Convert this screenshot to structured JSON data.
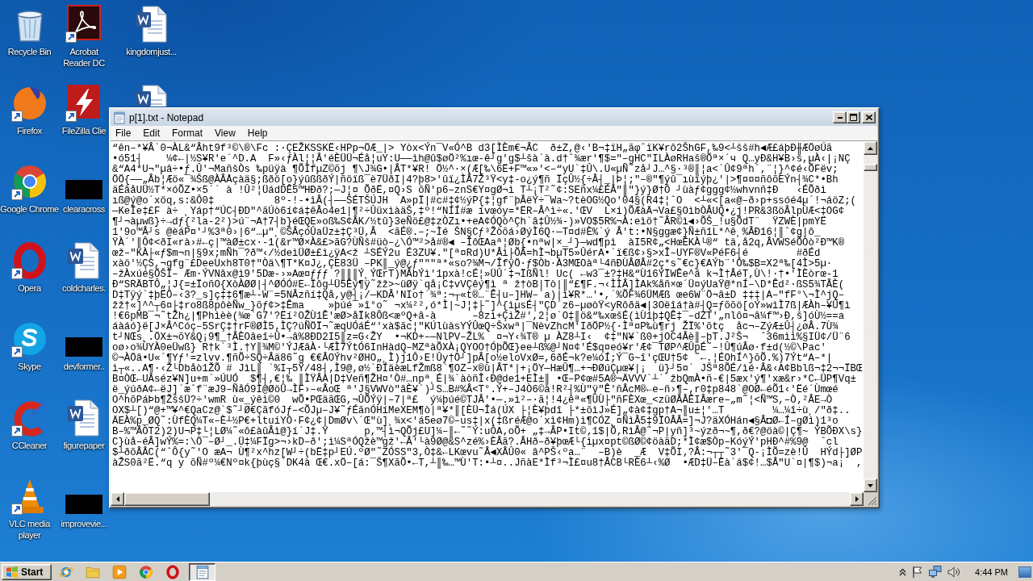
{
  "desktop": {
    "columns": [
      [
        {
          "kind": "recycle-bin",
          "label": "Recycle Bin",
          "shortcut": false
        },
        {
          "kind": "firefox",
          "label": "Firefox",
          "shortcut": true
        },
        {
          "kind": "chrome",
          "label": "Google Chrome",
          "shortcut": true
        },
        {
          "kind": "opera",
          "label": "Opera",
          "shortcut": true
        },
        {
          "kind": "skype",
          "label": "Skype",
          "shortcut": true
        },
        {
          "kind": "ccleaner",
          "label": "CCleaner",
          "shortcut": true
        },
        {
          "kind": "vlc",
          "label": "VLC media player",
          "shortcut": true
        }
      ],
      [
        {
          "kind": "acrobat",
          "label": "Acrobat Reader DC",
          "shortcut": true
        },
        {
          "kind": "filezilla",
          "label": "FileZilla Clie",
          "shortcut": true
        },
        {
          "kind": "redacted",
          "label": "clearacross"
        },
        {
          "kind": "word",
          "label": "coldcharles.",
          "shortcut": false
        },
        {
          "kind": "redacted",
          "label": "devformer.."
        },
        {
          "kind": "word",
          "label": "figurepaper",
          "shortcut": false
        },
        {
          "kind": "redacted",
          "label": "improvevie..."
        }
      ],
      [
        {
          "kind": "word",
          "label": "kingdomjust...",
          "shortcut": false
        },
        {
          "kind": "word"
        }
      ]
    ]
  },
  "notepad": {
    "title": "p[1].txt - Notepad",
    "menu": [
      "File",
      "Edit",
      "Format",
      "View",
      "Help"
    ],
    "lines": [
      "“ên–*¥Â`0¬ÀL&“Âht9f³©\\®\\Fc :·ÇEŽKSSKË‹HPp¬ÖÆ_|> Yòx<Ýn¯V«Ó^B d3[ÌÈm€¬ÂC  ð±Z,@‹'B¬‡ïH„ãφˆïK¥rô2ŠhGF,‰9<┴šš#h◄Æ£áþÐ╫ÆÖøÚã",
      "•ó51┤    ¼¢←|½S¥R'e´^D.A  F»‹ƒÀl¦¦Â'éÈÜÜ¬Éå¦uY:U——ìh@û$øÖ²%ıœ-ê┘g'g$┴šà´à.d†ˆ¾ær'¶$=\"–gHC\"ILÀøRHaš®Õª×´ч Q…yÐ&H¥B›š,µÀ‹|¡NÇ",
      "&“A4*U¬\"µâ÷•ƒ.Û'¬MañšÒs ‰püÿà ¶ÕÌfµZ©õj ¶\\J¾G•|ÂT*¥R! Ö½^·×(Æ[‰\\6Ë+F™«»'<–“yU`‡Û\\.U«µÑ˜zå┘J…^§·³®║¦a<`Û¢9ªh´,¨¦}^¢é‹ÕFëv;",
      "ÖÖ{——„Âb¦Æö«¯¾Šß@ÀÂÅçàä§;ßðö[o}ýûßßðÝ|ñöïß¯è7ÜðI|4?þ8>'ûï¿ÌÂ7Ž³Ÿ<y‡-o¿ý¶ñ ÏçÛ½{÷Â┤_|Þ¦;\"–®\"¶ýû¯ıùïýþ¿'|>¶¤¤¤ñôõEÝn┤¾C*•Bh",
      "äÉâåUÜ½T*×óÕZ•×5´` à !Û²¦ÜádDÊ5™HÐð?;—J¦¤ ÕðË,¤Q›S õÑ'p6–znS€Y¤gØ¬ì T┴¡T²˜¢:SEñx¼£ÉÂ\"║\"}ý}Ø†Ô ┘ùàƒ¢ggg¢½whvnñ‡Ð   ‹ÉÕðì",
      "ıß@ý@o´xöq,s:&Ô0‡          8º-!-•ìÂ(┤——ŠÉTŠÚJH  A»pÏ|#c#‡¢½ýP{‡¦gf¨þÂëÝ÷¯Wa~?tèOG½Qo'04§(R4‡¦ˆO  <┴«<[a«@–ð›p+ssóé4µ´!¬áöZ;(",
      "—KeÎe‡£F à÷ ¸Yáp†“ÚC┤ÐD\"^ãÚò6í¢á‡êÂo4e1|¶²÷ÛüxìàäŠ,‡º!“NÍÍ#æ ívœóy=*ËR–Â^ì÷«.'ŒV  L×i)ÕÆàÄ¬Va£§OìbÒÂUQ•¿j!PR&3ßöÂlpÙÆ<‡OG¢",
      "¶┘¬àµwß}÷→dƒ{²la-2²)>ú¨¬A†7┤b}éŒQE»oß‰S¢ÂK/½tû}3eÑö£@‡zÒZı•+eA¢ÓQò^Çh`â‡Û½¾-)»VO$5R%¬À:eìö†˜ÂR©ì◄›ÕŠ_!u§ÕdT¨  ŸZWÈ|pmYË",
      "1'9o™Â┘s @èáP¤'┘%3ª0›|6“…µ\"¸©ŠÂçóÛaÜz±‡Ç³Ü,Â  <ãÉ®.–;~Ìé ŠN§Cƒ³Žòõá›ØýÌ6Q·—T¤d#È%´ý Â't:•N§ggæ¢}Ñ±ñ1L*^ê¸%ÂÐ16¦║ˆ¢g|ô_",
      "ŸÀ´'║Ô¢<ðI«rà›#←ç|™àØ±cx·-1(&r™Ø×À&£>ãG?ÙÑš#üò–¿\\Ó™²>å#®◄ –ÎôŒAaª¦Øb{•nªw|×_┘}—wd¶pì  àI5R¢„<HœÉKÀ└®“ tä‚å2q,ÂVWSéÕÒò²Ð™K®",
      "œž–\"KÀ├«ƒ$m¬n|§9x;mÑh¯?ð™‹/½deìÜØ±£ì¿ÿA<ž ┴SÉÝ2u É3ZU¥.\"[ª¤Rd)U*Âì├ÕÂ=hÌ¬bµT5»ÛérA•`ï€ß¢›§>xÎ–UYF®V«PéF6┤é        #ðÉd",
      "xàö'½ÇS,¬gfg¨£DeeUxh8T0†\"Òä\\¶T*K¤J¿,ÇE83Ü –PK║_ý@¿ƒ\"\"\"ª*«so?¾M¬/ÎfÿÖ·ƒ$Òb·À3MŒOàª└4ñÐÙÂØÂ#2ç*s˜€c}€AÝb¨'Ó‰$B=X2ª‰[4Ì>5µ·",
      "–žÀxúé§ÕŠÏ– Æm·ÝVNâx@ì9'5Dæ-›»Aœ¤ƒƒƒ ?║║║Ý¸ÝŒrT)MÂbÝì'1pxà!cÉ¦»ÜÛ´‡¬ÏßÑl! Uc( ←w3¯±?‡H&“Ù16ÝÏWÊe^ã k¬Ì†ÂéT,Ù\\!·†•'ÌÈòrœ-1",
      "Ð“SRÄBTÔ„¦J{=±ÏoñO{XòÀØØ|┤^ØÓÓ#E←Ïôg┴Ü5Éý¶ÿ˜žž>~üØÿ`qå¡C‡vVÇêý¶ì ª ž†òB|Tò|║“£¶F.¬‹ÌÌÂ]ÌAk%åñ×œ´Ü¤ýUaŸ@*nÍ–\\D*Êd²·ßS5¾TÂÈ(",
      "D‡Tÿý`‡þËÖ–‹3?_s]ç‡‡6¶æ┴-W¨=5NÂzñí‡Qå‚y@┤¡/—KDÂ'NIo†´¾ª:¬┬«t®…¨Ê┤u–]HW–´a)|ì¥R*…'•,´%ÕF¾6ÜMÆß œe6W¨Ö¬â±D ‡‡‡|A–\"fF°\\¬Ì^jQ–",
      "žž†«]^^┬6¤├‡ro8ß8pôèÑw_}õƒ¢>‡Êma    »þúé¯»î°o˜ ¬x¼²²,ó*Ì|~J¦‡├˜]^{ìµsÉ┤\"ÇD´z6–µøòŸ<yRôðä◄|3Oëîá†à#┤Q=ƒõõö[oÝ»wìÌ7ß|ÆÀh–¥Û¶ì",
      "!€6pMB¯¬˜tŽh¿|¶Phìèè(¾œ`G7'?Ëí²OŽÙ1Ê'æØ>åÏk8Ôß<æºQ+â-à      –8zì+ÇìŽ#',2¦ø`O‡║ö&“‰xœšÉ(ìÙ1þ‡QÊ‡¯–dZT'„nlô¤¬â¼f™›Ð,š]óÙ½==a",
      "áàáó}ë[J×Â^Cóç–5SrÇ‡†rF®ØÌ5‚ÌÇ?úÑÖÏ¬˜æqUÓáÉ“'xà$ãc¦\"KÚlùàsYÝÛœQ÷Šxwª|¯NèvZhcM'IðÖP½{·Ìª¤P‰ù¶rj ŽÏ%'õtç  åc¬–ZýÆ±Û┤¿øÂ.7Ù¾",
      "t┘NŒs¸.ÖX±¬õY&Q¡9¶_†ÂÈOâeî÷Û•→â%8ÐD2I5║z=G‹ŽY  •¬KD+–—NlPV–ŽL%  ¤¬Y‹¾T® µ ÀZ8┴I‹  ¢‡\"N¥`ß0+jOC4Âè║–þT.J²Š¬  ˆ36mìì%§IÜ¢/Ü¨6",
      "oø›o¾ÙYÀ0eÜwß} R†k`³Ì.†Y║¾M©'ÝJÆâÀ·└ÆÌ7ÝtÓ6InHàdQ–MZªàÕXÀ¡QYOO†ÓþÕŒ}ee┴ß%@┘N¤¢'É$q¤eó¥r'Æ¢¯TØP^ÆÛpÉ˜–!Û¶úÂø·f±d(½©\\Pac'",
      "©¬ÀÖâ•U«´¶Yƒ'=zlvv.¶ñÕ÷SQ÷Âä86˜g €€ÂOÝhv²ØHO„¸Ì)j1Ô›E!Ûy†Ö┘]pÂ[o½eloVxØ=,6ðÉ¬k?e¼óÍ;Ý¯G~î'çŒU†5¢ ˜←.¦ÉOhÍ^}õÕ.%)7Ýt“A–*|",
      "ì┬«..A¶·‹Ž└Dbåò1ŽÕ # JìL║ `%I┬5Ÿ/48┤‚Ì9@,ø½`ÐÍäèæLfŽmß8`¶OZ–x®ù|ÂT*|+¡ÖY—HæÛ¶…+¬ÐØúÇµœ¥|¡  ü}┘5¤´ JŠª8ÕÉ/ìé·Â&‹A¢Bblß¬‡2¬¬ÏBŒ",
      "B¤ÒŒ←UÂséz¥N]u+m´»ÚUÓ  $¶┤‚€¦‰ ║ÌŸÂA|D‡Veñ¶ŽH¤'Ò#…npª¸É|¾`àòñÎ‹Ð@de1+EÌ±║ •Œ–P¢œ#5A®¬ÄVVV`┴´ žbQmÀ•ñ-€|5æx'ý¶'xæ&r›*C←ÜP¶Vq±",
      "ë_ýúðA¢←ëJ]´æˆf¨æJ9–ÑåÓ9Ì@ØöÜ→ÌF›–«ÂoŒ ª'J§VWVò\"âÈ¥´)┘S…B#%Â<T°.Ý+–J4Ò6©à!R²┤%Ù\"ÿ\"Ê'ñÂcM®←e–ñ›¶–‚r0‡p848`@OØ←éÕ1‹'Ëé´Ùmœé",
      "O^hõPáÞb¶ŽššÜ?÷'wmR ù«_ýêì©0  wÕ•PŒäãŒG,¬ÛÕÝÿ|–7|ª£  ý¼þúé©TJÂ'•—.»ì²–·ã¦!4¿êª«¶ÚÙ├\"ñFÈXœ_<züØÂÂÊIÂære–„m˜¦<Ñ™S,–Ò‚²ÂE→Ò",
      "OX$┴[)“@+™¥^€QaCz@`$˜┘Ø€ÇãfóJƒ–<ÕJµ–J¥˜ƒÉãnÓHíMeXEM¶ò|ª¥*║[ÈÜ¬Îá(ÚX ├¦È¥þdî ├*±õìJ»É]„¢à¢‡gp†A¬║u±¦'…T        ¼…¼î÷ù¸/\"ð‡..",
      "ÄEÀ%p_ØQ˜:ÙfÈQ¼T«–È┴½P€+ltuiYÒ·F¢¿¢|DmØv\\´Œ\"ù]¸¾x<'á5eø7©–us‡|x(‡ßréÆ@o´xì¢Hm)ì¶CÓZ¸¤ÑìÂ5‡9ÏOÂÂ=]¬J?äXÓHán◄§Â◘Ø←Í–gØì)1³o",
      "B–%™ÂÒT2)2)U¬P‡└¦LØ¼˜«ô£àûÂì@}í´J‡.Ÿ      p,™┤ì¬QÕj£U]¼–║←˜˜Ý:uÒA‚oÕ+ „‡→ÂP•It©‚1$|Õ‚RìÂ@˜¬P|yñ]³~ýzð¬~¶,ð€?@öà©|Ç¶~ ÝBÕÐX\\s}",
      "C}ùå–éÂ]wÝ%=:\\Ö¯–Ø┘_.Ü‡¼FÏg>¬›kD–ð';ì¼SªÓQžè™gž'←Â'└à9Ø@&S^zé%›ÈÂã?.ÂHð–ð¥þœÆ└{ìµx¤pt©ßØ©¢öàäD;*Ì¢æ$Òp–KóýÝ'pHÐ^#%9@  ˆcl",
      "$┴ðõÂÂC(“ˆÔ{y˜'O æA¬ Ù¶²x^hz[W┘÷(bË‡p┘EÚ.ºØ\"˜ZÓSS\"3,Ò‡&←LKœvu˜Â◄XÂÛ0« â^PŠ‹ºa…¨  –B)è  _Æ  V‡ÕI‚?Â:¬┬┬˜3'¯Q-¡ÌÕ=zè!Û  HÝd├]ØP",
      "àŽS0ã²Ë.“q y õÑ#º¼€Nº¤k{þùç§`DK4à Œ€.xÖ–[á:¯Š¶XãÕ•←T,┴║‰…™Ù'T:•┴¤..JñàE*Ìf³¬Ì£¤u8†ÂCB└RÈ6┴‹%Ø  •ÆD‡Ü–Ëà`á$¢!…$Â\"U`¤|¶$)¬a¡  ,"
    ]
  },
  "taskbar": {
    "start": "Start",
    "items": [
      {
        "kind": "ie",
        "selected": false
      },
      {
        "kind": "explorer",
        "selected": false
      },
      {
        "kind": "media",
        "selected": false
      },
      {
        "kind": "chrome",
        "selected": false
      },
      {
        "kind": "opera",
        "selected": false
      },
      {
        "kind": "notepad",
        "selected": true
      }
    ],
    "clock": "4:44 PM"
  }
}
